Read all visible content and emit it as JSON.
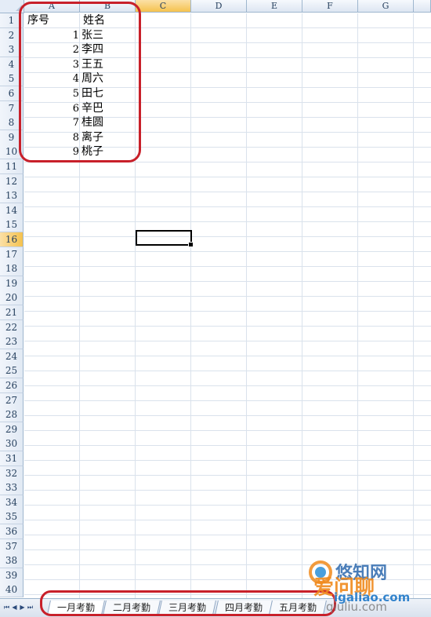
{
  "columns": [
    "A",
    "B",
    "C",
    "D",
    "E",
    "F",
    "G"
  ],
  "active_column": "C",
  "rows": [
    "1",
    "2",
    "3",
    "4",
    "5",
    "6",
    "7",
    "8",
    "9",
    "10",
    "11",
    "12",
    "13",
    "14",
    "15",
    "16",
    "17",
    "18",
    "19",
    "20",
    "21",
    "22",
    "23",
    "24",
    "25",
    "26",
    "27",
    "28",
    "29",
    "30",
    "31",
    "32",
    "33",
    "34",
    "35",
    "36",
    "37",
    "38",
    "39",
    "40"
  ],
  "active_row": "16",
  "headers": {
    "a1": "序号",
    "b1": "姓名"
  },
  "data_rows": [
    {
      "num": "1",
      "name": "张三"
    },
    {
      "num": "2",
      "name": "李四"
    },
    {
      "num": "3",
      "name": "王五"
    },
    {
      "num": "4",
      "name": "周六"
    },
    {
      "num": "5",
      "name": "田七"
    },
    {
      "num": "6",
      "name": "辛巴"
    },
    {
      "num": "7",
      "name": "桂圆"
    },
    {
      "num": "8",
      "name": "离子"
    },
    {
      "num": "9",
      "name": "桃子"
    }
  ],
  "sheet_tabs": [
    "一月考勤",
    "二月考勤",
    "三月考勤",
    "四月考勤",
    "五月考勤"
  ],
  "nav_icons": [
    "first-sheet-icon",
    "prev-sheet-icon",
    "next-sheet-icon",
    "last-sheet-icon"
  ],
  "watermark": {
    "line1": "悠知网",
    "line2": "爱问聊",
    "line3": "igaliao.com",
    "line4": "qiuliu.com"
  },
  "colors": {
    "annotation": "#c8202a",
    "header_active": "#f5c24e",
    "grid": "#dae2ec"
  }
}
